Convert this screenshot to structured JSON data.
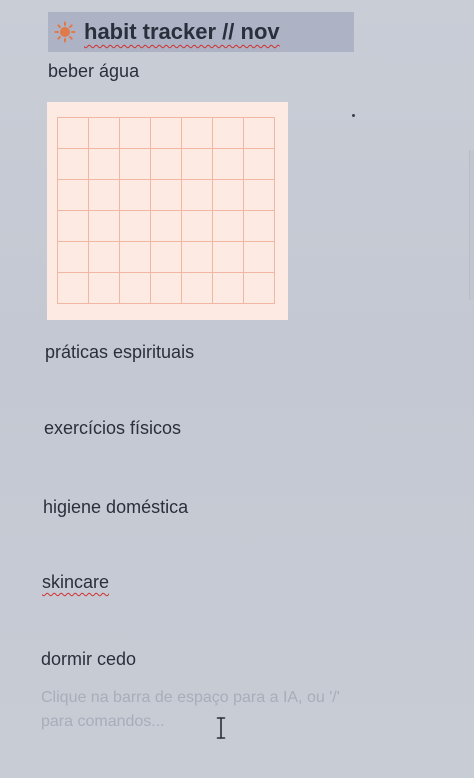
{
  "header": {
    "title": "habit tracker // nov",
    "icon": "sun-icon"
  },
  "habits": [
    {
      "label": "beber água"
    },
    {
      "label": "práticas espirituais"
    },
    {
      "label": "exercícios físicos"
    },
    {
      "label": "higiene doméstica"
    },
    {
      "label": "skincare"
    },
    {
      "label": "dormir cedo"
    }
  ],
  "tracker": {
    "rows": 6,
    "columns": 7
  },
  "editor": {
    "placeholder": "Clique na barra de espaço para a IA, ou '/' para comandos..."
  },
  "colors": {
    "background": "#c6cad3",
    "title_bar": "#adb2c4",
    "tracker_fill": "#fdebe3",
    "tracker_lines": "#f0b8a2",
    "spellcheck": "#d03030",
    "sun_icon": "#e07a4a"
  }
}
